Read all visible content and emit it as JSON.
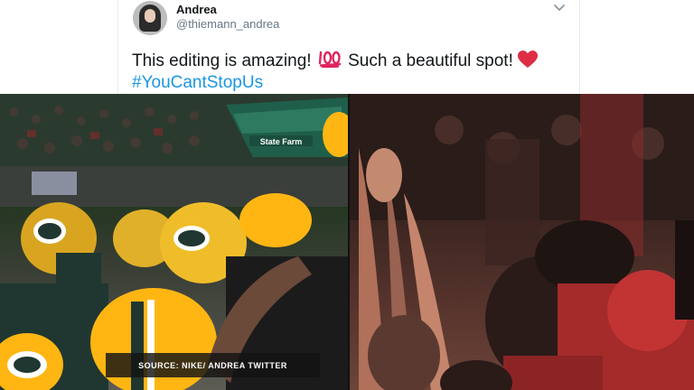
{
  "tweet": {
    "user": {
      "name": "Andrea",
      "handle": "@thiemann_andrea"
    },
    "text_part1": "This editing is amazing! ",
    "text_part2": " Such a beautiful spot! ",
    "hashtag": "#YouCantStopUs",
    "icons": [
      "hundred-points-emoji",
      "red-heart-emoji",
      "chevron-down-icon"
    ]
  },
  "media": {
    "left_image": {
      "signage": "State Farm"
    },
    "caption": "SOURCE: NIKE/ ANDREA TWITTER"
  },
  "colors": {
    "hashtag": "#1b95e0",
    "handle": "#657786",
    "text": "#14171a",
    "heart": "#e0245e",
    "packers_green": "#203731",
    "packers_gold": "#ffb612"
  }
}
